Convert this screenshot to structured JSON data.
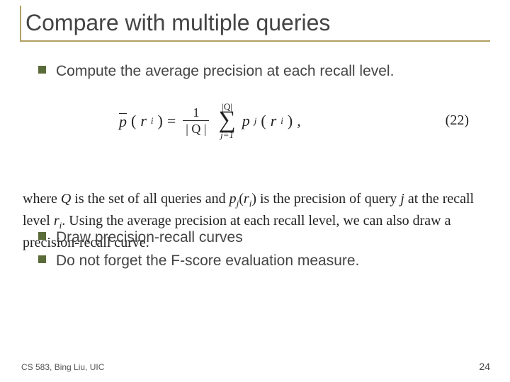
{
  "title": "Compare with multiple queries",
  "bullets": {
    "b1": "Compute the average precision at each recall level.",
    "b2": "Draw precision-recall curves",
    "b3": "Do not forget the F-score evaluation measure."
  },
  "equation": {
    "lhs_p": "p",
    "lhs_arg_open": "(",
    "lhs_r": "r",
    "lhs_i": "i",
    "lhs_arg_close": ")",
    "eq": "=",
    "frac_num": "1",
    "frac_den": "| Q |",
    "sum_top": "|Q|",
    "sum_sym": "∑",
    "sum_bot": "j=1",
    "rhs_p": "p",
    "rhs_j": "j",
    "rhs_arg_open": "(",
    "rhs_r": "r",
    "rhs_i": "i",
    "rhs_arg_close": ")",
    "comma": ",",
    "number": "(22)"
  },
  "explain": {
    "w_where": "where ",
    "w_Q": "Q",
    "w_mid1": " is the set of all queries and ",
    "w_pj": "p",
    "w_j": "j",
    "w_open": "(",
    "w_r": "r",
    "w_i": "i",
    "w_close": ")",
    "w_mid2": " is the precision of query ",
    "w_jplain": "j",
    "w_mid3": " at the recall level ",
    "w_r2": "r",
    "w_i2": "i",
    "w_dot": ". Using the average precision at each recall level, we can also draw a precision-recall curve."
  },
  "footer": {
    "left": "CS 583, Bing Liu, UIC",
    "right": "24"
  }
}
